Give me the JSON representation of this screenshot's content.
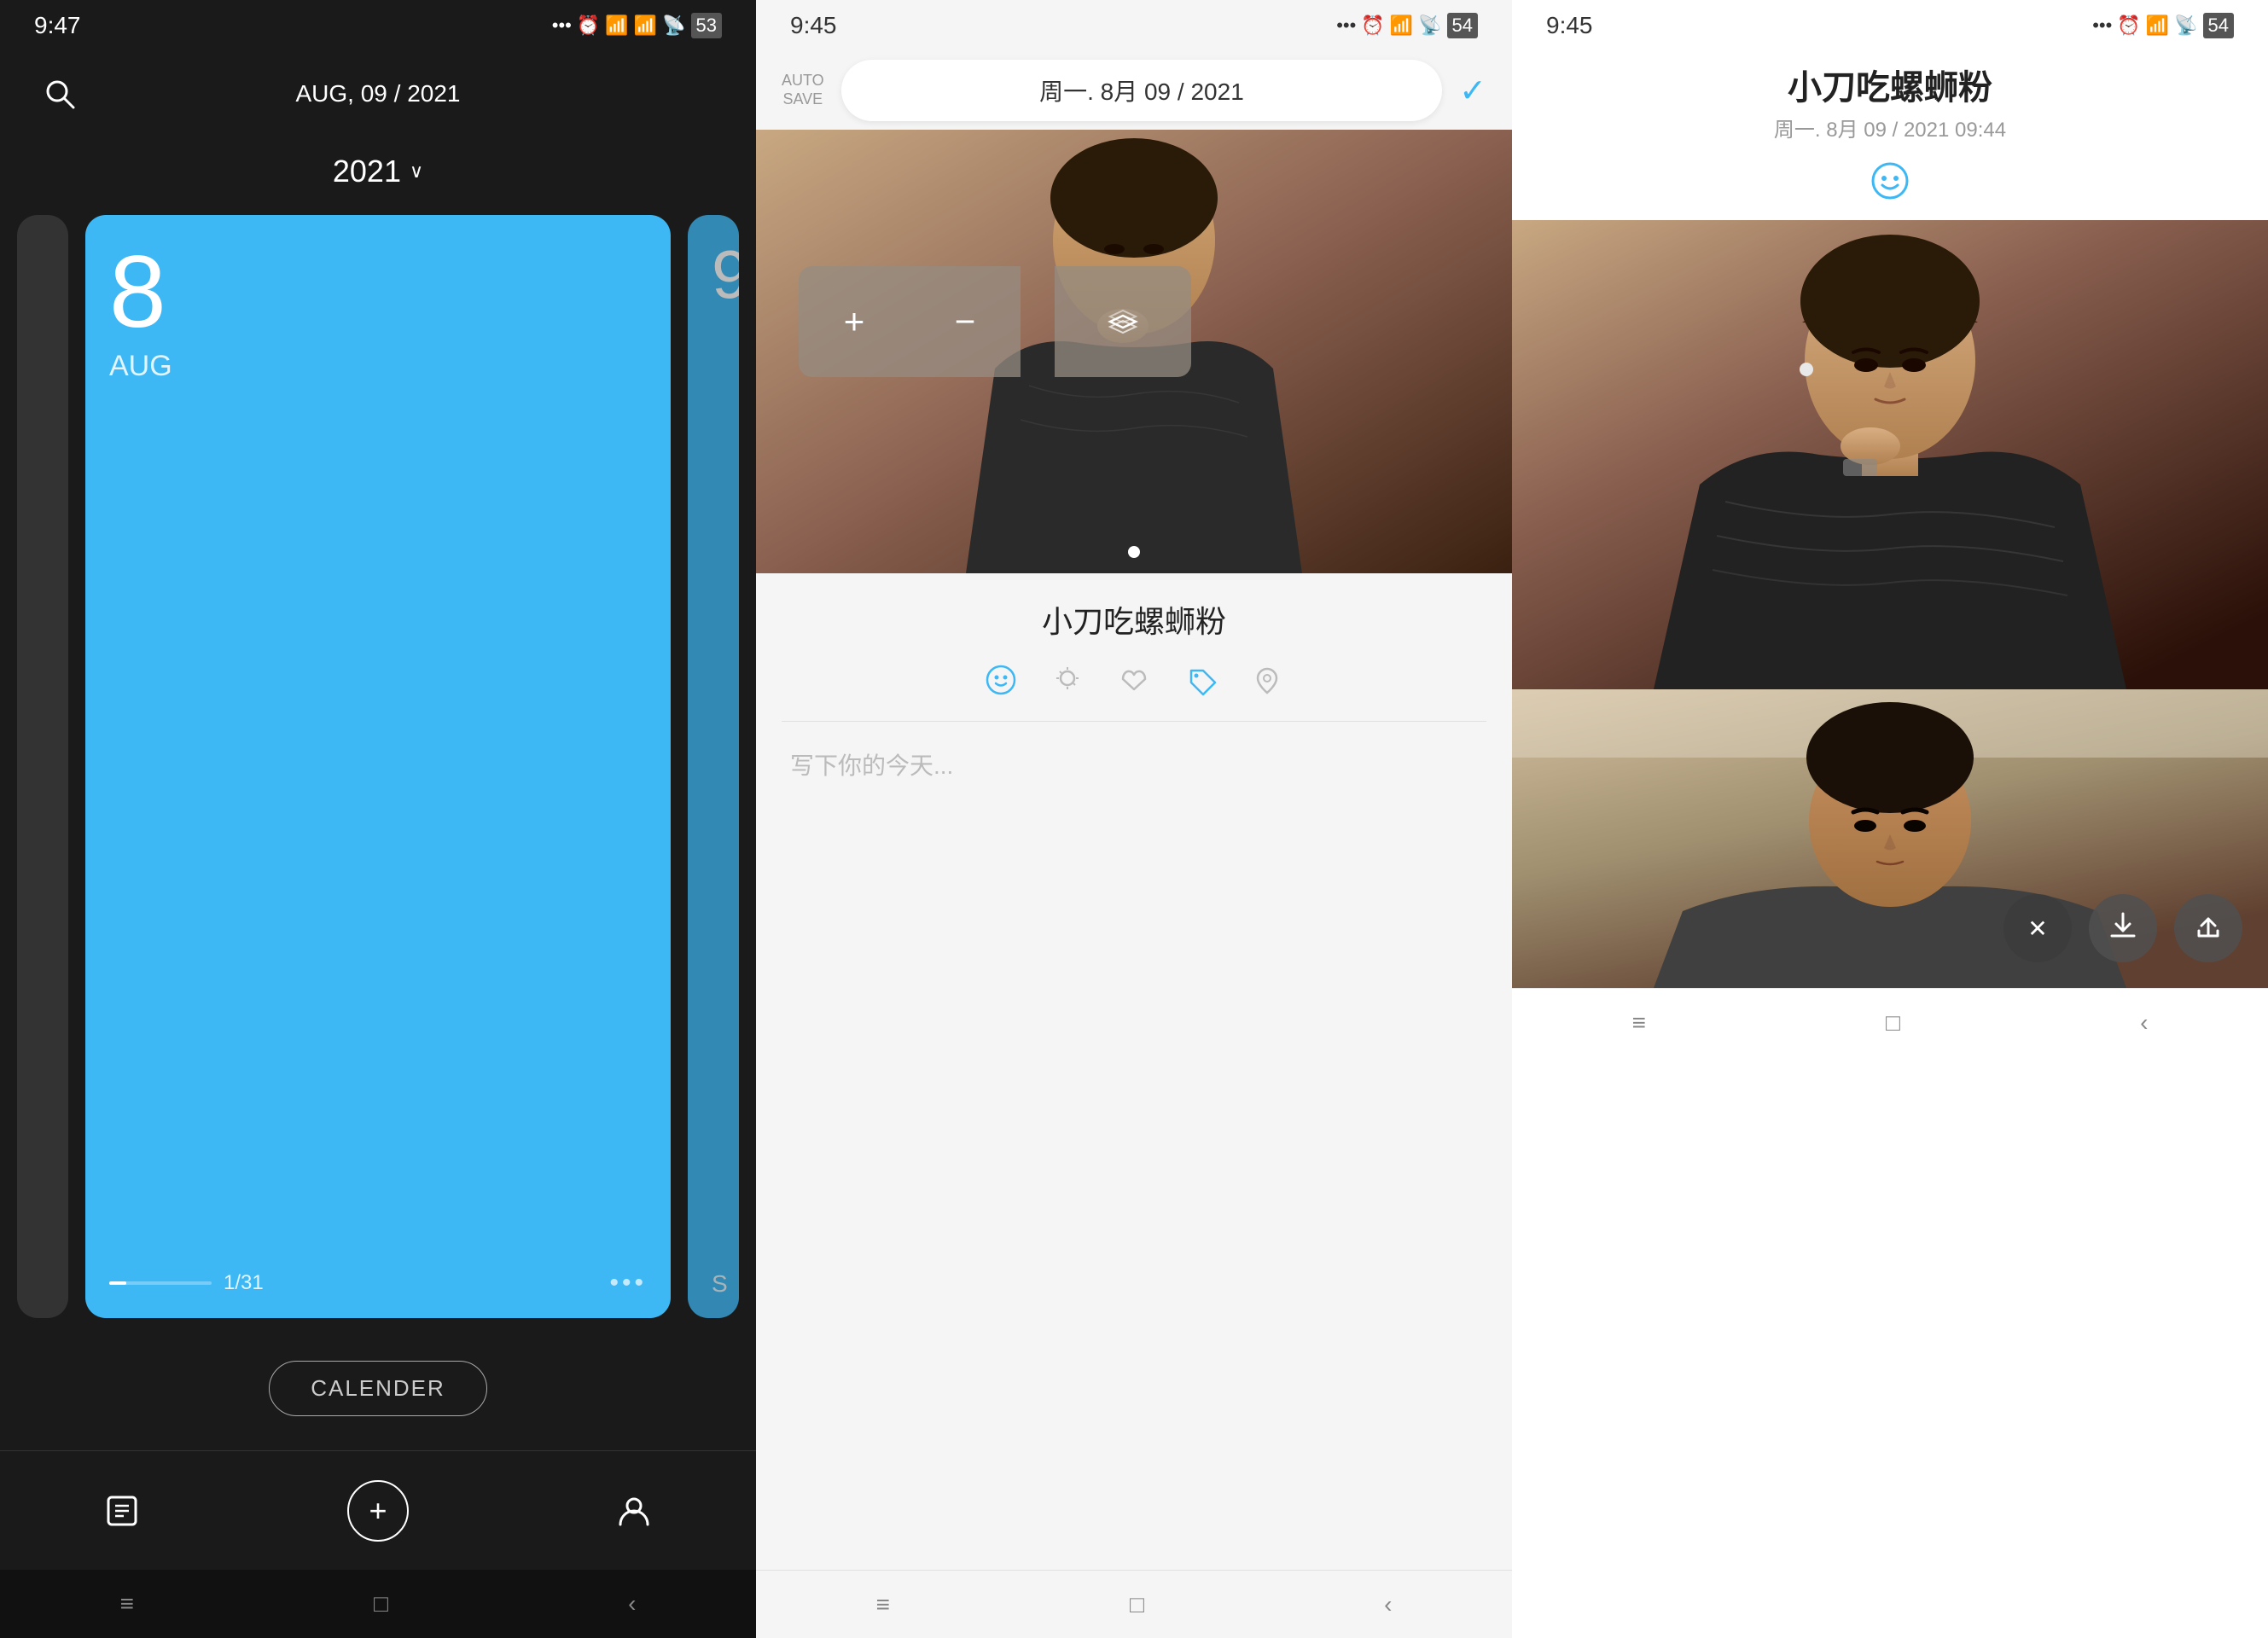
{
  "panel1": {
    "status": {
      "time": "9:47",
      "icons": "... ⏰ 📶 📶 WiFi 53"
    },
    "header": {
      "date": "AUG, 09 / 2021"
    },
    "year": {
      "label": "2021"
    },
    "card": {
      "day": "8",
      "month": "AUG",
      "count": "1/31"
    },
    "calender_btn": "CALENDER",
    "nav": {
      "book_icon": "📔",
      "add_icon": "+",
      "profile_icon": "👤"
    },
    "bottom": {
      "menu": "≡",
      "home": "□",
      "back": "‹"
    }
  },
  "panel2": {
    "status": {
      "time": "9:45",
      "icons": "... ⏰ 📶 WiFi 54"
    },
    "header": {
      "autosave_line1": "AUTO",
      "autosave_line2": "SAVE",
      "date": "周一. 8月 09 / 2021"
    },
    "entry": {
      "title": "小刀吃螺蛳粉",
      "placeholder": "写下你的今天...",
      "mood_icon": "😊",
      "weather_icon": "☀",
      "heart_icon": "♡",
      "tag_icon": "🏷",
      "location_icon": "📍"
    },
    "bottom": {
      "menu": "≡",
      "home": "□",
      "back": "‹"
    }
  },
  "panel3": {
    "status": {
      "time": "9:45",
      "icons": "... ⏰ 📶 WiFi 54"
    },
    "entry": {
      "title": "小刀吃螺蛳粉",
      "subtitle": "周一. 8月 09 / 2021 09:44",
      "mood_icon": "😊"
    },
    "actions": {
      "close": "✕",
      "download": "↓",
      "share": "↑"
    },
    "bottom": {
      "menu": "≡",
      "home": "□",
      "back": "‹"
    }
  }
}
